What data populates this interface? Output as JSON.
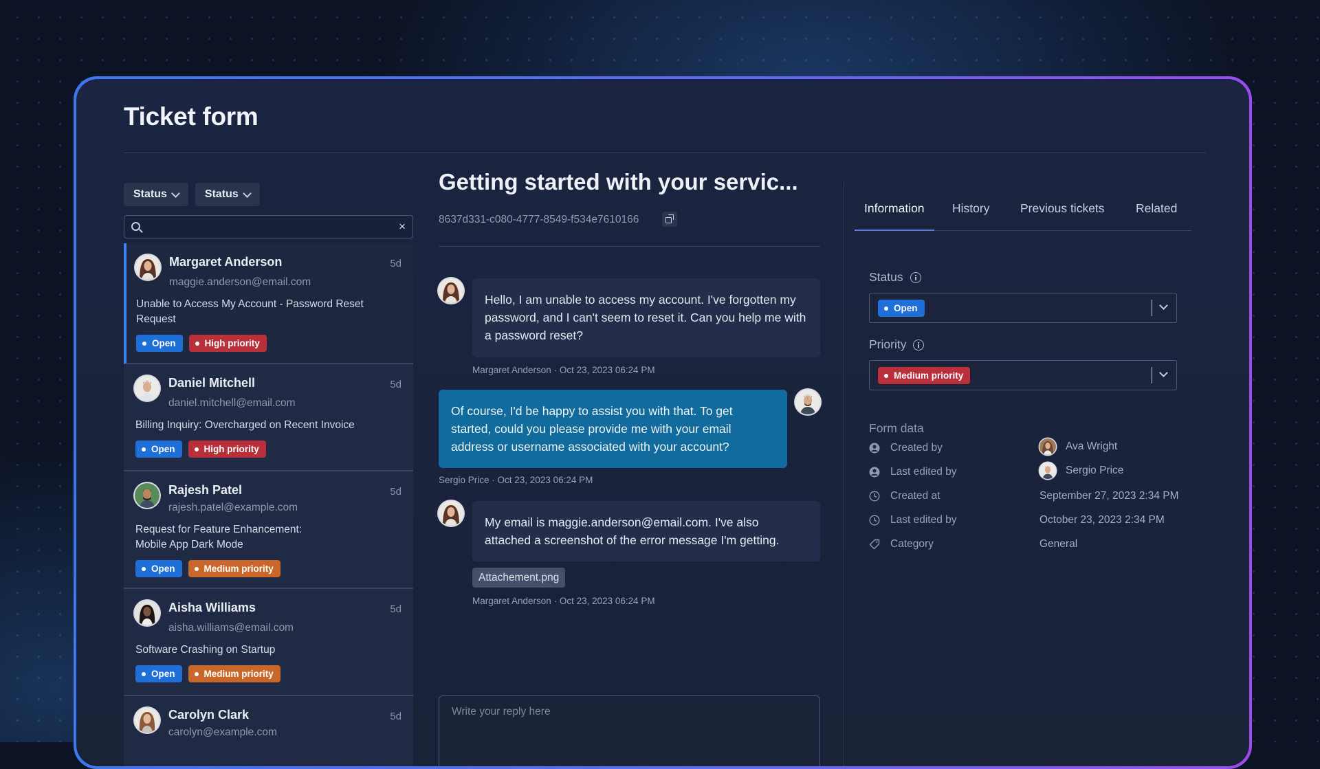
{
  "page": {
    "title": "Ticket form"
  },
  "filters": [
    "Status",
    "Status"
  ],
  "search": {
    "value": "",
    "placeholder": ""
  },
  "tickets": [
    {
      "name": "Margaret Anderson",
      "email": "maggie.anderson@email.com",
      "time": "5d",
      "subject": "Unable to Access My Account - Password Reset Request",
      "status": "Open",
      "priority": "High priority"
    },
    {
      "name": "Daniel Mitchell",
      "email": "daniel.mitchell@email.com",
      "time": "5d",
      "subject": "Billing Inquiry: Overcharged on Recent Invoice",
      "status": "Open",
      "priority": "High priority"
    },
    {
      "name": "Rajesh Patel",
      "email": "rajesh.patel@example.com",
      "time": "5d",
      "subject": "Request for Feature Enhancement: Mobile App Dark Mode",
      "status": "Open",
      "priority": "Medium priority"
    },
    {
      "name": "Aisha Williams",
      "email": "aisha.williams@email.com",
      "time": "5d",
      "subject": "Software Crashing on Startup",
      "status": "Open",
      "priority": "Medium priority"
    },
    {
      "name": "Carolyn Clark",
      "email": "carolyn@example.com",
      "time": "5d",
      "subject": "",
      "status": "",
      "priority": ""
    }
  ],
  "conversation": {
    "title": "Getting started with your servic...",
    "id": "8637d331-c080-4777-8549-f534e7610166",
    "messages": [
      {
        "text": "Hello, I am unable to access my account. I've forgotten my password, and I can't seem to reset it. Can you help me with a password reset?",
        "meta": "Margaret Anderson · Oct 23, 2023 06:24 PM"
      },
      {
        "text": "Of course, I'd be happy to assist you with that. To get started, could you please provide me with your email address or username associated with your account?",
        "meta": "Sergio Price · Oct 23, 2023 06:24 PM"
      },
      {
        "text": "My email is maggie.anderson@email.com. I've also attached a screenshot of the error message I'm getting.",
        "attachment": "Attachement.png",
        "meta": "Margaret Anderson · Oct 23, 2023 06:24 PM"
      }
    ],
    "reply_placeholder": "Write your reply here"
  },
  "details": {
    "tabs": [
      "Information",
      "History",
      "Previous tickets",
      "Related"
    ],
    "status_label": "Status",
    "status_value": "Open",
    "priority_label": "Priority",
    "priority_value": "Medium priority",
    "form_title": "Form data",
    "rows": [
      {
        "label": "Created by",
        "value": "Ava Wright",
        "icon": "user-circle-icon"
      },
      {
        "label": "Last edited by",
        "value": "Sergio Price",
        "icon": "user-circle-icon"
      },
      {
        "label": "Created at",
        "value": "September 27, 2023 2:34 PM",
        "icon": "clock-icon"
      },
      {
        "label": "Last edited by",
        "value": "October 23, 2023 2:34 PM",
        "icon": "clock-icon"
      },
      {
        "label": "Category",
        "value": "General",
        "icon": "tag-icon"
      }
    ]
  },
  "colors": {
    "accent": "#3d82f4",
    "open": "#1f6fd9",
    "high": "#b9303a",
    "medium": "#c9672a",
    "agent_bubble": "#116b9c"
  }
}
